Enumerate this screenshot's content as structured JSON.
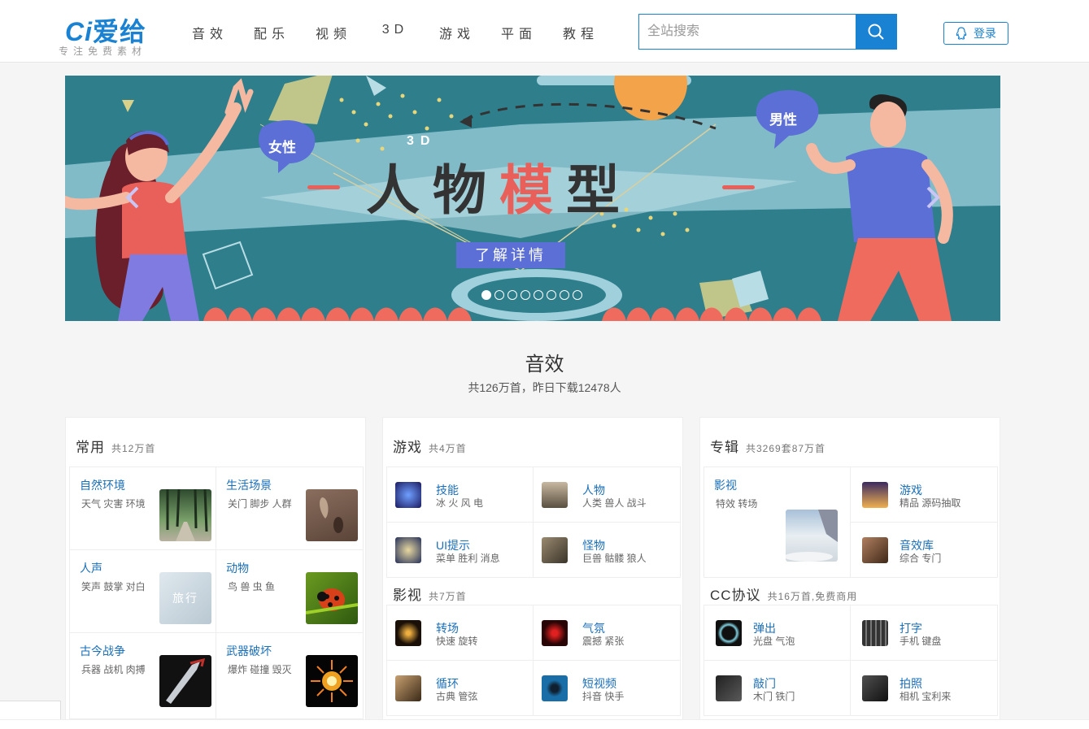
{
  "logo": {
    "brand": "爱给",
    "mark": "Ci",
    "tagline": "专注免费素材"
  },
  "nav": [
    "音效",
    "配乐",
    "视频",
    "3D",
    "游戏",
    "平面",
    "教程"
  ],
  "search": {
    "placeholder": "全站搜索",
    "icon": "search-icon"
  },
  "login": {
    "label": "登录",
    "icon": "qq-penguin-icon"
  },
  "banner": {
    "tag": "3D",
    "title_a": "人物",
    "title_hl": "模",
    "title_b": "型",
    "female": "女性",
    "male": "男性",
    "detail": "了解详情",
    "slide_count": 8,
    "active_slide": 0
  },
  "section": {
    "title": "音效",
    "subtitle": "共126万首，昨日下载12478人"
  },
  "cards": {
    "common": {
      "title": "常用",
      "count": "共12万首",
      "items": [
        {
          "name": "自然环境",
          "tags": "天气 灾害 环境"
        },
        {
          "name": "生活场景",
          "tags": "关门 脚步 人群"
        },
        {
          "name": "人声",
          "tags": "笑声 鼓掌 对白"
        },
        {
          "name": "动物",
          "tags": "鸟 兽 虫 鱼"
        },
        {
          "name": "古今战争",
          "tags": "兵器 战机 肉搏"
        },
        {
          "name": "武器破坏",
          "tags": "爆炸 碰撞 毁灭"
        }
      ],
      "thumb_text": "旅行"
    },
    "game": {
      "title": "游戏",
      "count": "共4万首",
      "items": [
        {
          "name": "技能",
          "tags": "冰 火 风 电"
        },
        {
          "name": "人物",
          "tags": "人类 兽人 战斗"
        },
        {
          "name": "UI提示",
          "tags": "菜单 胜利 消息"
        },
        {
          "name": "怪物",
          "tags": "巨兽 骷髅 狼人"
        }
      ]
    },
    "film": {
      "title": "影视",
      "count": "共7万首",
      "items": [
        {
          "name": "转场",
          "tags": "快速 旋转"
        },
        {
          "name": "气氛",
          "tags": "震撼 紧张"
        },
        {
          "name": "循环",
          "tags": "古典 管弦"
        },
        {
          "name": "短视频",
          "tags": "抖音 快手"
        }
      ]
    },
    "album": {
      "title": "专辑",
      "count": "共3269套87万首",
      "items": [
        {
          "name": "影视",
          "tags": "特效 转场"
        },
        {
          "name": "游戏",
          "tags": "精品 源码抽取"
        },
        {
          "name": "音效库",
          "tags": "综合 专门"
        }
      ]
    },
    "cc": {
      "title": "CC协议",
      "count": "共16万首,免费商用",
      "items": [
        {
          "name": "弹出",
          "tags": "光盘 气泡"
        },
        {
          "name": "打字",
          "tags": "手机 键盘"
        },
        {
          "name": "敲门",
          "tags": "木门 铁门"
        },
        {
          "name": "拍照",
          "tags": "相机 宝利来"
        }
      ]
    }
  },
  "colors": {
    "brand": "#1a82d2",
    "link": "#1a6fb8",
    "banner_bg": "#2e7d8a",
    "accent": "#e9605a"
  }
}
